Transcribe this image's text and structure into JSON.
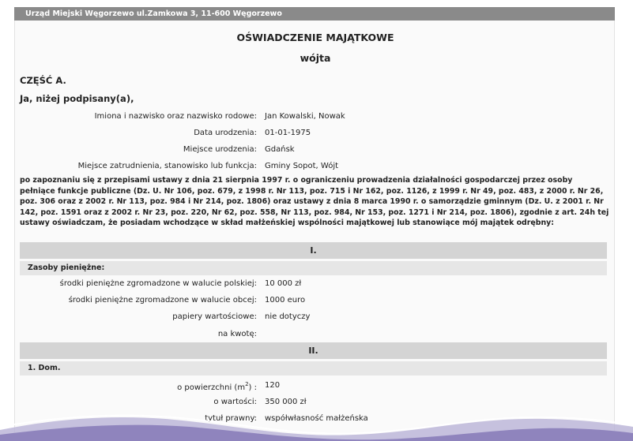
{
  "header": {
    "address": "Urząd Miejski Węgorzewo ul.Zamkowa 3, 11-600 Węgorzewo"
  },
  "document": {
    "title": "OŚWIADCZENIE MAJĄTKOWE",
    "subtitle": "wójta",
    "part": "CZĘŚĆ A.",
    "intro": "Ja, niżej podpisany(a),"
  },
  "personal": [
    {
      "label": "Imiona i nazwisko oraz nazwisko rodowe:",
      "value": "Jan Kowalski, Nowak"
    },
    {
      "label": "Data urodzenia:",
      "value": "01-01-1975"
    },
    {
      "label": "Miejsce urodzenia:",
      "value": "Gdańsk"
    },
    {
      "label": "Miejsce zatrudnienia, stanowisko lub funkcja:",
      "value": "Gminy Sopot, Wójt"
    }
  ],
  "statement": "po zapoznaniu się z przepisami ustawy z dnia 21 sierpnia 1997 r. o ograniczeniu prowadzenia działalności gospodarczej przez osoby pełniące funkcje publiczne (Dz. U. Nr 106, poz. 679, z 1998 r. Nr 113, poz. 715 i Nr 162, poz. 1126, z 1999 r. Nr 49, poz. 483, z 2000 r. Nr 26, poz. 306 oraz z 2002 r. Nr 113, poz. 984 i Nr 214, poz. 1806) oraz ustawy z dnia 8 marca 1990 r. o samorządzie gminnym (Dz. U. z 2001 r. Nr 142, poz. 1591 oraz z 2002 r. Nr 23, poz. 220, Nr 62, poz. 558, Nr 113, poz. 984, Nr 153, poz. 1271 i Nr 214, poz. 1806), zgodnie z art. 24h tej ustawy oświadczam, że posiadam wchodzące w skład małżeńskiej wspólności majątkowej lub stanowiące mój majątek odrębny:",
  "section1": {
    "header": "I.",
    "subheader": "Zasoby pieniężne:",
    "rows": [
      {
        "label": "środki pieniężne zgromadzone w walucie polskiej:",
        "value": "10 000 zł"
      },
      {
        "label": "środki pieniężne zgromadzone w walucie obcej:",
        "value": "1000 euro"
      },
      {
        "label": "papiery wartościowe:",
        "value": "nie dotyczy"
      },
      {
        "label": "na kwotę:",
        "value": ""
      }
    ]
  },
  "section2": {
    "header": "II.",
    "subheader": "1. Dom.",
    "area_label": "o powierzchni (m",
    "area_sup": "2",
    "area_label_end": ") :",
    "area_value": "120",
    "rows": [
      {
        "label": "o wartości:",
        "value": "350 000 zł"
      },
      {
        "label": "tytuł prawny:",
        "value": "współwłasność małżeńska"
      }
    ]
  }
}
